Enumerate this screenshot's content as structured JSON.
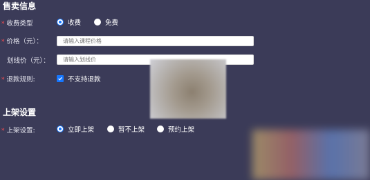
{
  "sales_section": {
    "title": "售卖信息",
    "fee_type": {
      "label": "收费类型",
      "options": [
        {
          "label": "收费",
          "checked": true
        },
        {
          "label": "免费",
          "checked": false
        }
      ]
    },
    "price": {
      "label": "价格（元）：",
      "placeholder": "请输入课程价格",
      "value": ""
    },
    "strike_price": {
      "label": "划线价（元）：",
      "placeholder": "请输入划线价",
      "value": ""
    },
    "refund_rule": {
      "label": "退款规则:",
      "checkbox_label": "不支持退款",
      "checked": true
    }
  },
  "shelf_section": {
    "title": "上架设置",
    "label": "上架设置:",
    "options": [
      {
        "label": "立即上架",
        "checked": true
      },
      {
        "label": "暂不上架",
        "checked": false
      },
      {
        "label": "预约上架",
        "checked": false
      }
    ]
  },
  "colors": {
    "background": "#3b3b58",
    "accent": "#1677ff",
    "required": "#ff4d4f"
  }
}
